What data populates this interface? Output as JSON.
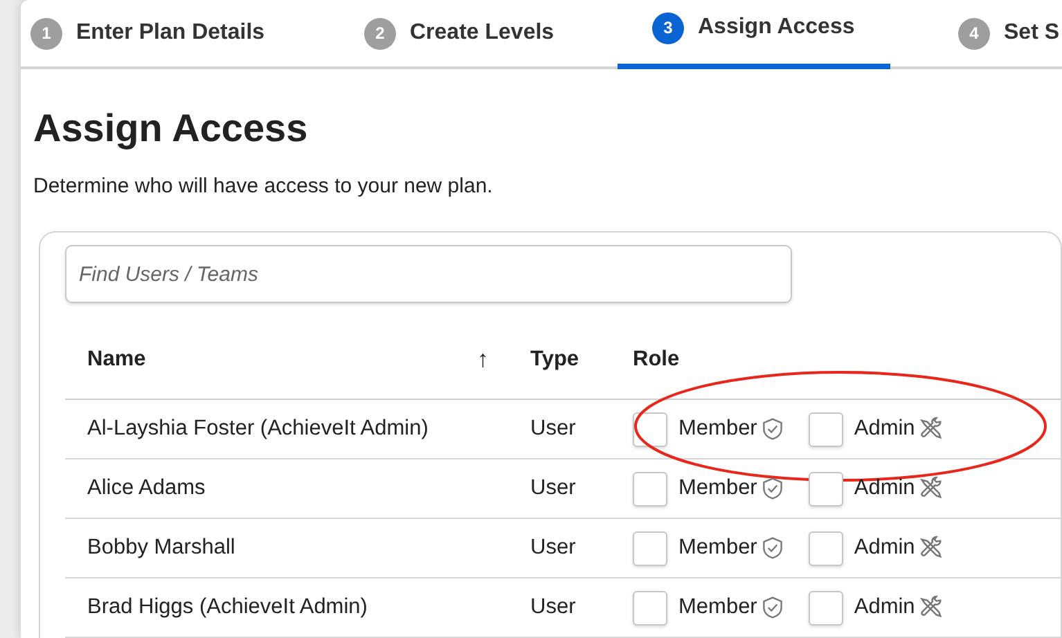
{
  "steps": [
    {
      "number": "1",
      "label": "Enter Plan Details",
      "selected": false
    },
    {
      "number": "2",
      "label": "Create Levels",
      "selected": false
    },
    {
      "number": "3",
      "label": "Assign Access",
      "selected": true
    },
    {
      "number": "4",
      "label": "Set S",
      "selected": false
    }
  ],
  "heading": "Assign Access",
  "description": "Determine who will have access to your new plan.",
  "search": {
    "placeholder": "Find Users / Teams"
  },
  "table": {
    "columns": [
      {
        "label": "Name",
        "sort": "↑"
      },
      {
        "label": "Type"
      },
      {
        "label": "Role"
      }
    ],
    "rows": [
      {
        "name": "Al-Layshia Foster (AchieveIt Admin)",
        "type": "User",
        "highlighted": true,
        "member": {
          "label": "Member",
          "checked": false
        },
        "admin": {
          "label": "Admin",
          "checked": false
        }
      },
      {
        "name": "Alice Adams",
        "type": "User",
        "highlighted": false,
        "member": {
          "label": "Member",
          "checked": false
        },
        "admin": {
          "label": "Admin",
          "checked": false
        }
      },
      {
        "name": "Bobby Marshall",
        "type": "User",
        "highlighted": false,
        "member": {
          "label": "Member",
          "checked": false
        },
        "admin": {
          "label": "Admin",
          "checked": false
        }
      },
      {
        "name": "Brad Higgs (AchieveIt Admin)",
        "type": "User",
        "highlighted": false,
        "member": {
          "label": "Member",
          "checked": false
        },
        "admin": {
          "label": "Admin",
          "checked": false
        }
      }
    ]
  }
}
